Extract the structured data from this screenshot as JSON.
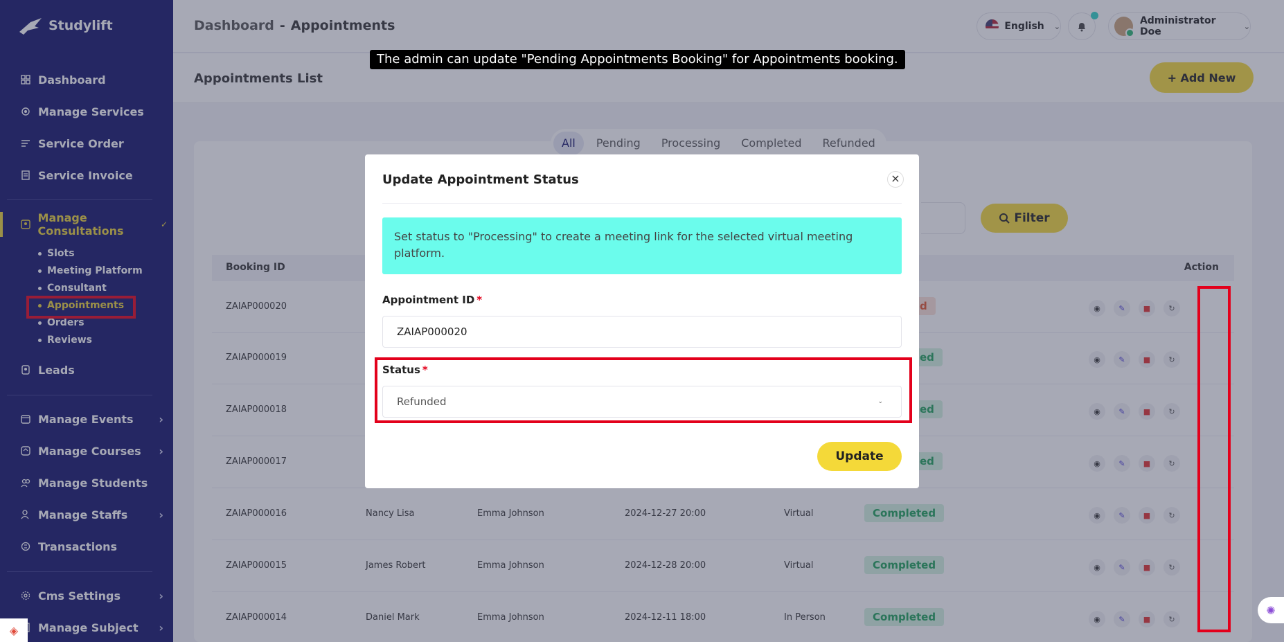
{
  "app": {
    "name": "Studylift"
  },
  "sidebar": {
    "items": [
      {
        "label": "Dashboard",
        "icon": "dashboard-icon"
      },
      {
        "label": "Manage Services",
        "icon": "services-icon"
      },
      {
        "label": "Service Order",
        "icon": "order-icon"
      },
      {
        "label": "Service Invoice",
        "icon": "invoice-icon"
      },
      {
        "label": "Manage Consultations",
        "icon": "consultation-icon"
      },
      {
        "label": "Leads",
        "icon": "leads-icon"
      },
      {
        "label": "Manage Events",
        "icon": "events-icon"
      },
      {
        "label": "Manage Courses",
        "icon": "courses-icon"
      },
      {
        "label": "Manage Students",
        "icon": "students-icon"
      },
      {
        "label": "Manage Staffs",
        "icon": "staffs-icon"
      },
      {
        "label": "Transactions",
        "icon": "transactions-icon"
      },
      {
        "label": "Cms Settings",
        "icon": "cms-icon"
      },
      {
        "label": "Manage Subject",
        "icon": "subject-icon"
      }
    ],
    "consultation_sub": [
      "Slots",
      "Meeting Platform",
      "Consultant",
      "Appointments",
      "Orders",
      "Reviews"
    ]
  },
  "header": {
    "crumb_root": "Dashboard",
    "crumb_sep": "-",
    "crumb_current": "Appointments",
    "language": "English",
    "user_name": "Administrator Doe"
  },
  "tooltip": "The admin can update \"Pending Appointments Booking\" for Appointments booking.",
  "subhead": {
    "title": "Appointments List",
    "add_label": "+ Add New"
  },
  "tabs": [
    "All",
    "Pending",
    "Processing",
    "Completed",
    "Refunded"
  ],
  "filter": {
    "label": "Filter"
  },
  "table": {
    "col_booking": "Booking ID",
    "col_action": "Action",
    "rows": [
      {
        "id": "ZAIAP000020",
        "student": "",
        "consultant": "",
        "datetime": "",
        "type": "",
        "status": ""
      },
      {
        "id": "ZAIAP000019",
        "student": "",
        "consultant": "",
        "datetime": "",
        "type": "",
        "status": ""
      },
      {
        "id": "ZAIAP000018",
        "student": "",
        "consultant": "",
        "datetime": "",
        "type": "",
        "status": ""
      },
      {
        "id": "ZAIAP000017",
        "student": "",
        "consultant": "",
        "datetime": "",
        "type": "",
        "status": ""
      },
      {
        "id": "ZAIAP000016",
        "student": "Nancy Lisa",
        "consultant": "Emma Johnson",
        "datetime": "2024-12-27 20:00",
        "type": "Virtual",
        "status": "Completed"
      },
      {
        "id": "ZAIAP000015",
        "student": "James Robert",
        "consultant": "Emma Johnson",
        "datetime": "2024-12-28 20:00",
        "type": "Virtual",
        "status": "Completed"
      },
      {
        "id": "ZAIAP000014",
        "student": "Daniel Mark",
        "consultant": "Emma Johnson",
        "datetime": "2024-12-11 18:00",
        "type": "In Person",
        "status": "Completed"
      }
    ],
    "partial_status": [
      "d",
      "ed",
      "ed",
      "ed"
    ]
  },
  "modal": {
    "title": "Update Appointment Status",
    "close": "×",
    "alert": "Set status to \"Processing\" to create a meeting link for the selected virtual meeting platform.",
    "id_label": "Appointment ID",
    "required_mark": "*",
    "id_value": "ZAIAP000020",
    "status_label": "Status",
    "status_value": "Refunded",
    "update_label": "Update"
  },
  "colors": {
    "sidebar_bg": "#13136b",
    "accent": "#f4d939",
    "active_nav": "#e9d13a",
    "alert_bg": "#6bfcec",
    "highlight": "#e3001b",
    "success": "#1ea05a"
  }
}
